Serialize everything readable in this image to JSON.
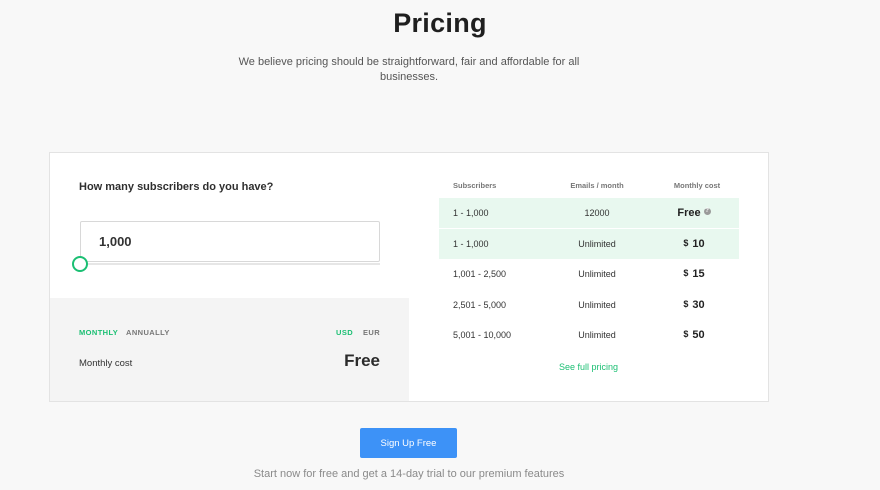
{
  "header": {
    "title": "Pricing",
    "subtitle": "We believe pricing should be straightforward, fair and affordable for all businesses."
  },
  "calculator": {
    "question": "How many subscribers do you have?",
    "subscribers_value": "1,000",
    "slider_level": 0,
    "billing": {
      "monthly": "MONTHLY",
      "annually": "ANNUALLY",
      "selected": "MONTHLY"
    },
    "currency": {
      "usd": "USD",
      "eur": "EUR",
      "selected": "USD"
    },
    "cost_label": "Monthly cost",
    "cost_value": "Free"
  },
  "pricing_table": {
    "headers": [
      "Subscribers",
      "Emails / month",
      "Monthly cost"
    ],
    "rows": [
      {
        "subscribers": "1 - 1,000",
        "emails": "12000",
        "currency": "",
        "price": "Free",
        "highlight": true,
        "help": "?"
      },
      {
        "subscribers": "1 - 1,000",
        "emails": "Unlimited",
        "currency": "$",
        "price": "10",
        "highlight": true
      },
      {
        "subscribers": "1,001 - 2,500",
        "emails": "Unlimited",
        "currency": "$",
        "price": "15",
        "highlight": false
      },
      {
        "subscribers": "2,501 - 5,000",
        "emails": "Unlimited",
        "currency": "$",
        "price": "30",
        "highlight": false
      },
      {
        "subscribers": "5,001 - 10,000",
        "emails": "Unlimited",
        "currency": "$",
        "price": "50",
        "highlight": false
      }
    ],
    "full_pricing_link": "See full pricing"
  },
  "cta": {
    "button_label": "Sign Up Free",
    "note": "Start now for free and get a 14-day trial to our premium features"
  },
  "colors": {
    "accent": "#1bbf73",
    "button": "#3d92f7",
    "highlight": "#e8f8ef"
  }
}
